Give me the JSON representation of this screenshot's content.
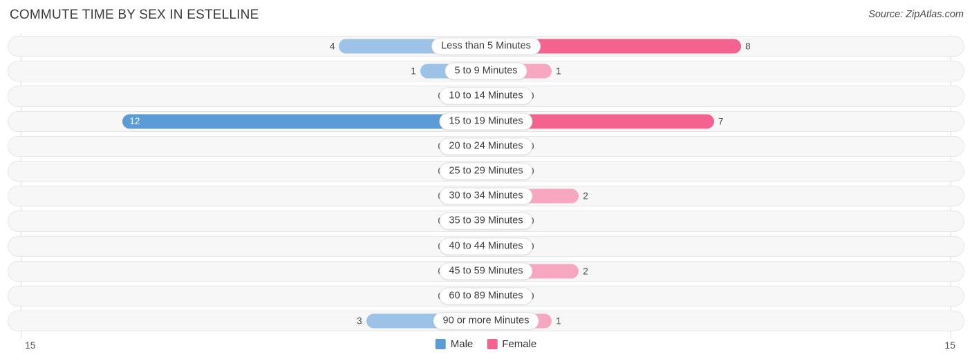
{
  "header": {
    "title": "COMMUTE TIME BY SEX IN ESTELLINE",
    "source": "Source: ZipAtlas.com"
  },
  "legend": {
    "male_label": "Male",
    "female_label": "Female",
    "male_color": "#5b9bd8",
    "female_color": "#f4638f"
  },
  "axis": {
    "left_end": "15",
    "right_end": "15",
    "max": 15
  },
  "colors": {
    "male_light": "#9dc2e8",
    "male_dark": "#5b9bd8",
    "female_light": "#f7a8c0",
    "female_dark": "#f4638f",
    "track_bg": "#f7f7f7",
    "track_border": "#e6e6e6"
  },
  "chart_data": {
    "type": "bar",
    "title": "COMMUTE TIME BY SEX IN ESTELLINE",
    "subtitle": "Source: ZipAtlas.com",
    "orientation": "horizontal-diverging",
    "xlabel": "",
    "ylabel": "",
    "xlim": [
      15,
      15
    ],
    "grid": false,
    "legend_position": "bottom-center",
    "categories": [
      "Less than 5 Minutes",
      "5 to 9 Minutes",
      "10 to 14 Minutes",
      "15 to 19 Minutes",
      "20 to 24 Minutes",
      "25 to 29 Minutes",
      "30 to 34 Minutes",
      "35 to 39 Minutes",
      "40 to 44 Minutes",
      "45 to 59 Minutes",
      "60 to 89 Minutes",
      "90 or more Minutes"
    ],
    "series": [
      {
        "name": "Male",
        "values": [
          4,
          1,
          0,
          12,
          0,
          0,
          0,
          0,
          0,
          0,
          0,
          3
        ]
      },
      {
        "name": "Female",
        "values": [
          8,
          1,
          0,
          7,
          0,
          0,
          2,
          0,
          0,
          2,
          0,
          1
        ]
      }
    ]
  },
  "rows": [
    {
      "label": "Less than 5 Minutes",
      "male": "4",
      "female": "8",
      "male_val": 4,
      "female_val": 8,
      "male_highlight": false,
      "female_highlight": true
    },
    {
      "label": "5 to 9 Minutes",
      "male": "1",
      "female": "1",
      "male_val": 1,
      "female_val": 1,
      "male_highlight": false,
      "female_highlight": false
    },
    {
      "label": "10 to 14 Minutes",
      "male": "0",
      "female": "0",
      "male_val": 0,
      "female_val": 0,
      "male_highlight": false,
      "female_highlight": false
    },
    {
      "label": "15 to 19 Minutes",
      "male": "12",
      "female": "7",
      "male_val": 12,
      "female_val": 7,
      "male_highlight": true,
      "female_highlight": true
    },
    {
      "label": "20 to 24 Minutes",
      "male": "0",
      "female": "0",
      "male_val": 0,
      "female_val": 0,
      "male_highlight": false,
      "female_highlight": false
    },
    {
      "label": "25 to 29 Minutes",
      "male": "0",
      "female": "0",
      "male_val": 0,
      "female_val": 0,
      "male_highlight": false,
      "female_highlight": false
    },
    {
      "label": "30 to 34 Minutes",
      "male": "0",
      "female": "2",
      "male_val": 0,
      "female_val": 2,
      "male_highlight": false,
      "female_highlight": false
    },
    {
      "label": "35 to 39 Minutes",
      "male": "0",
      "female": "0",
      "male_val": 0,
      "female_val": 0,
      "male_highlight": false,
      "female_highlight": false
    },
    {
      "label": "40 to 44 Minutes",
      "male": "0",
      "female": "0",
      "male_val": 0,
      "female_val": 0,
      "male_highlight": false,
      "female_highlight": false
    },
    {
      "label": "45 to 59 Minutes",
      "male": "0",
      "female": "2",
      "male_val": 0,
      "female_val": 2,
      "male_highlight": false,
      "female_highlight": false
    },
    {
      "label": "60 to 89 Minutes",
      "male": "0",
      "female": "0",
      "male_val": 0,
      "female_val": 0,
      "male_highlight": false,
      "female_highlight": false
    },
    {
      "label": "90 or more Minutes",
      "male": "3",
      "female": "1",
      "male_val": 3,
      "female_val": 1,
      "male_highlight": false,
      "female_highlight": false
    }
  ]
}
